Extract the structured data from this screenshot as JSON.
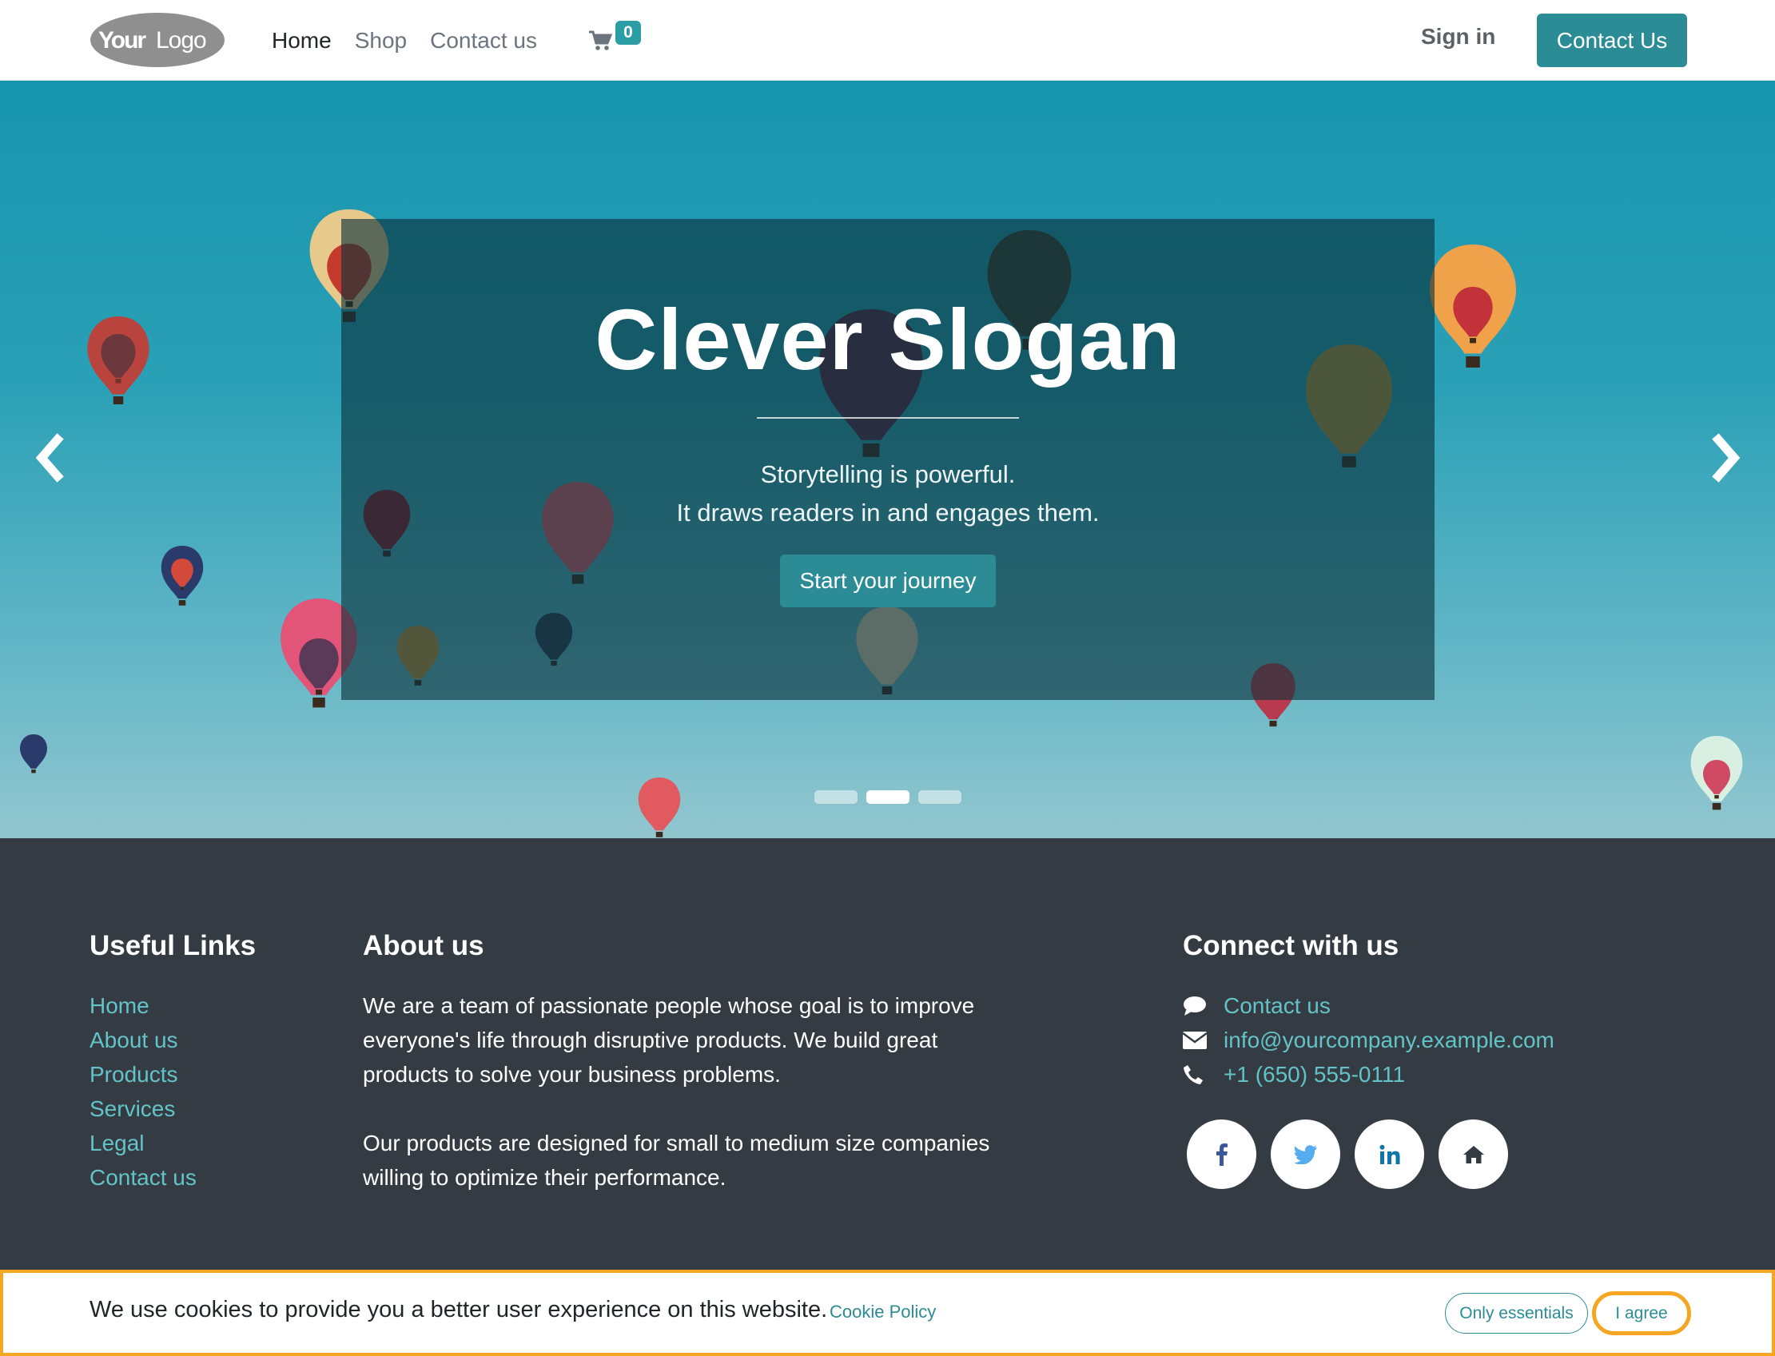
{
  "header": {
    "logo_text": "YourLogo",
    "nav": [
      "Home",
      "Shop",
      "Contact us"
    ],
    "cart_count": "0",
    "sign_in": "Sign in",
    "contact_button": "Contact Us"
  },
  "hero": {
    "title": "Clever Slogan",
    "line1": "Storytelling is powerful.",
    "line2": "It draws readers in and engages them.",
    "cta": "Start your journey",
    "slides": 3,
    "active_slide": 2
  },
  "footer": {
    "useful_links_title": "Useful Links",
    "useful_links": [
      "Home",
      "About us",
      "Products",
      "Services",
      "Legal",
      "Contact us"
    ],
    "about_title": "About us",
    "about_p1": "We are a team of passionate people whose goal is to improve everyone's life through disruptive products. We build great products to solve your business problems.",
    "about_p2": "Our products are designed for small to medium size companies willing to optimize their performance.",
    "connect_title": "Connect with us",
    "connect": {
      "contact": "Contact us",
      "email": "info@yourcompany.example.com",
      "phone": "+1 (650) 555-0111"
    },
    "socials": [
      "facebook-icon",
      "twitter-icon",
      "linkedin-icon",
      "home-icon"
    ]
  },
  "cookie": {
    "message": "We use cookies to provide you a better user experience on this website.",
    "policy_link": "Cookie Policy",
    "essentials": "Only essentials",
    "agree": "I agree"
  },
  "colors": {
    "accent": "#2b8c95",
    "link": "#63c3c9",
    "footer_bg": "#353b42",
    "highlight": "#f5a623"
  }
}
